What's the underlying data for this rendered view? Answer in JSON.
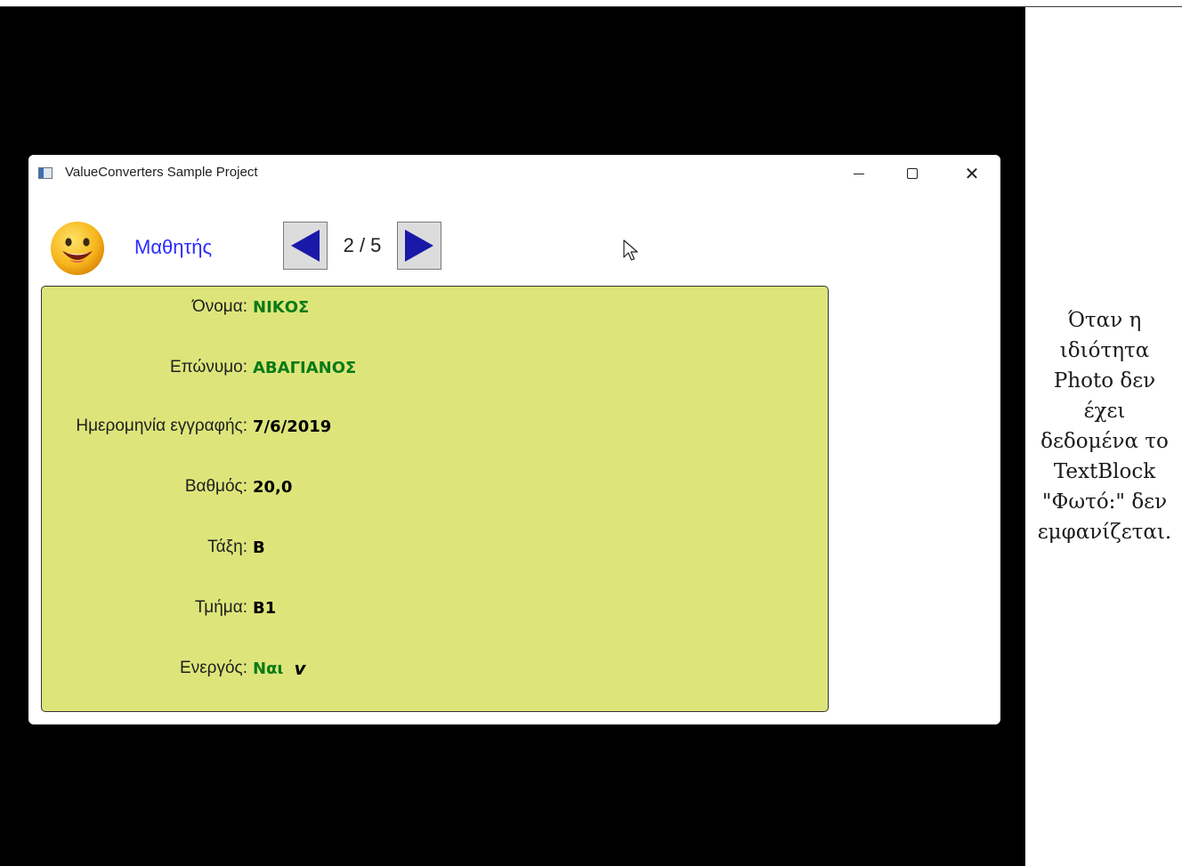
{
  "window": {
    "title": "ValueConverters Sample Project"
  },
  "header": {
    "section_label": "Μαθητής",
    "page_indicator": "2 / 5"
  },
  "student": {
    "rows": [
      {
        "label": "Όνομα:",
        "value": "ΝΙΚΟΣ",
        "value_color": "#0a7a17"
      },
      {
        "label": "Επώνυμο:",
        "value": "ΑΒΑΓΙΑΝΟΣ",
        "value_color": "#0a7a17"
      },
      {
        "label": "Ημερομηνία εγγραφής:",
        "value": "7/6/2019",
        "value_color": "#000000"
      },
      {
        "label": "Βαθμός:",
        "value": "20,0",
        "value_color": "#000000"
      },
      {
        "label": "Τάξη:",
        "value": "Β",
        "value_color": "#000000"
      },
      {
        "label": "Τμήμα:",
        "value": "Β1",
        "value_color": "#000000"
      },
      {
        "label": "Ενεργός:",
        "value": "Ναι",
        "value_color": "#0a7a17",
        "check_glyph": "v"
      }
    ]
  },
  "side_note": {
    "lines": [
      "Όταν η",
      "ιδιότητα",
      "Photo δεν",
      "έχει",
      "δεδομένα το",
      "TextBlock",
      "\"Φωτό:\" δεν",
      "εμφανίζεται."
    ]
  },
  "colors": {
    "panel_background": "#dde57a",
    "accent_blue": "#2b2bff",
    "nav_arrow": "#1a18a8",
    "value_green": "#0a7a17"
  },
  "icons": {
    "app": "window-app-icon",
    "avatar": "smiley-face-icon",
    "prev": "triangle-left-icon",
    "next": "triangle-right-icon",
    "cursor": "mouse-pointer-icon",
    "active": "check-mark-icon"
  }
}
